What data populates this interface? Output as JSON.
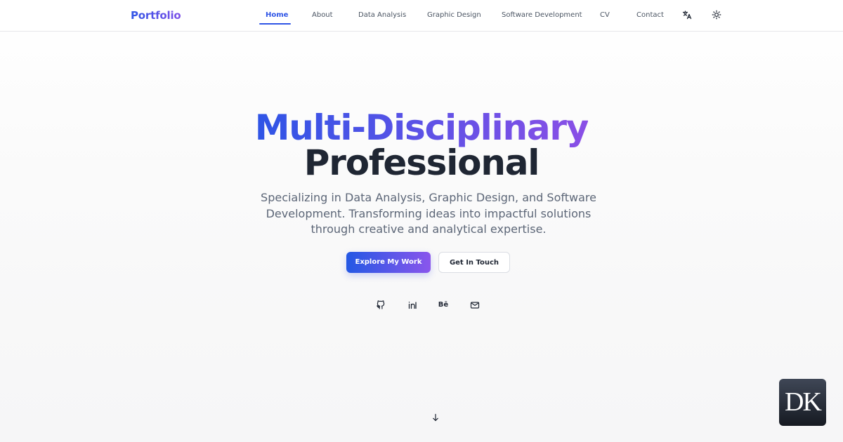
{
  "header": {
    "logo": "Portfolio",
    "nav": {
      "home": "Home",
      "about": "About",
      "data_analysis": "Data Analysis",
      "graphic_design": "Graphic Design",
      "software_development": "Software Development",
      "cv": "CV",
      "contact": "Contact"
    },
    "active_item": "Home",
    "icons": [
      "translate-icon",
      "sun-icon"
    ]
  },
  "hero": {
    "title_line1": "Multi-Disciplinary",
    "title_line2": "Professional",
    "subtitle": "Specializing in Data Analysis, Graphic Design, and Software Development. Transforming ideas into impactful solutions through creative and analytical expertise.",
    "primary_button": "Explore My Work",
    "secondary_button": "Get In Touch"
  },
  "social": {
    "behance_label": "Bē",
    "icons": [
      "github-icon",
      "linkedin-icon",
      "behance-icon",
      "mail-icon"
    ]
  },
  "scroll_icon": "arrow-down-icon",
  "badge": {
    "text": "DK"
  },
  "colors": {
    "accent_blue": "#2f55e6",
    "accent_purple": "#8a4fe6",
    "heading": "#1f2633",
    "body_text": "#5c6677",
    "background": "#fafafa"
  }
}
